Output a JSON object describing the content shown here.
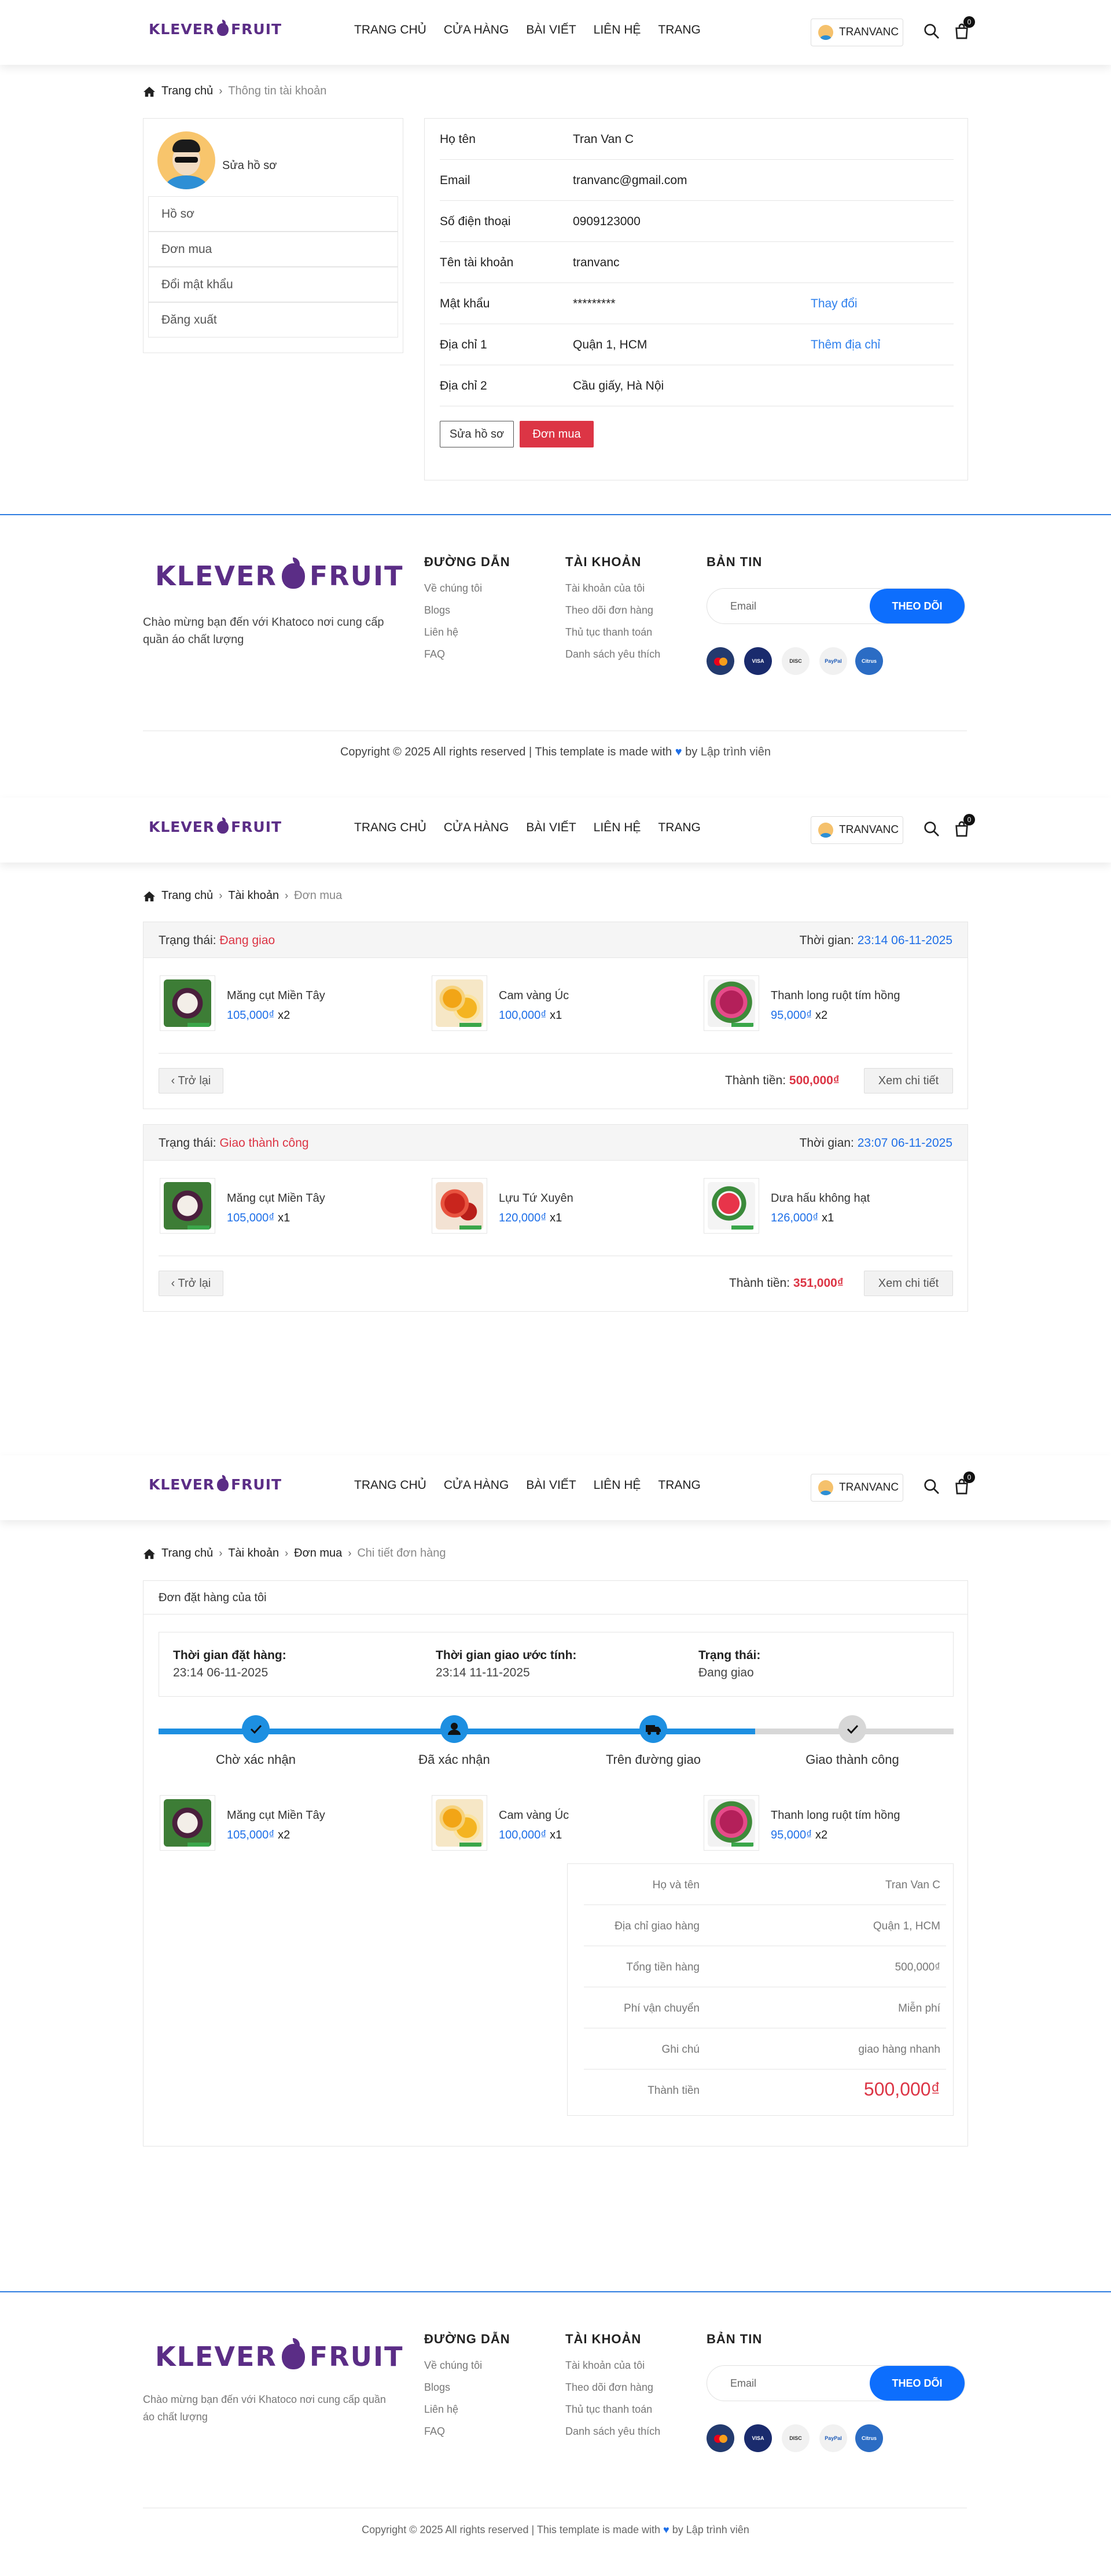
{
  "header": {
    "logo_left": "KLEVER",
    "logo_right": "FRUIT",
    "nav": [
      "TRANG CHỦ",
      "CỬA HÀNG",
      "BÀI VIẾT",
      "LIÊN HỆ",
      "TRANG"
    ],
    "username": "TRANVANC",
    "cart_count": "0"
  },
  "profile_page": {
    "breadcrumb": {
      "home": "Trang chủ",
      "current": "Thông tin tài khoản"
    },
    "sidebar": {
      "edit_label": "Sửa hồ sơ",
      "items": [
        "Hồ sơ",
        "Đơn mua",
        "Đổi mật khẩu",
        "Đăng xuất"
      ]
    },
    "rows": [
      {
        "label": "Họ tên",
        "value": "Tran Van C",
        "action": ""
      },
      {
        "label": "Email",
        "value": "tranvanc@gmail.com",
        "action": ""
      },
      {
        "label": "Số điện thoại",
        "value": "0909123000",
        "action": ""
      },
      {
        "label": "Tên tài khoản",
        "value": "tranvanc",
        "action": ""
      },
      {
        "label": "Mật khẩu",
        "value": "*********",
        "action": "Thay đổi"
      },
      {
        "label": "Địa chỉ 1",
        "value": "Quận 1, HCM",
        "action": "Thêm địa chỉ"
      },
      {
        "label": "Địa chỉ 2",
        "value": "Cầu giấy, Hà Nội",
        "action": ""
      }
    ],
    "edit_button": "Sửa hồ sơ",
    "orders_button": "Đơn mua"
  },
  "footer": {
    "logo_left": "KLEVER",
    "logo_right": "FRUIT",
    "description": "Chào mừng bạn đến với Khatoco nơi cung cấp quần áo chất lượng",
    "col1": {
      "title": "ĐƯỜNG DẪN",
      "links": [
        "Về chúng tôi",
        "Blogs",
        "Liên hệ",
        "FAQ"
      ]
    },
    "col2": {
      "title": "TÀI KHOẢN",
      "links": [
        "Tài khoản của tôi",
        "Theo dõi đơn hàng",
        "Thủ tục thanh toán",
        "Danh sách yêu thích"
      ]
    },
    "col3": {
      "title": "BẢN TIN",
      "email_placeholder": "Email",
      "subscribe": "THEO DÕI"
    },
    "payments": [
      "MasterCard",
      "VISA",
      "DISCOVER",
      "PayPal",
      "Citrus"
    ],
    "copyright_pre": "Copyright © 2025 All rights reserved | This template is made with",
    "copyright_by": "by",
    "copyright_author": "Lập trình viên"
  },
  "orders_page": {
    "breadcrumb": {
      "home": "Trang chủ",
      "mid": "Tài khoản",
      "current": "Đơn mua"
    },
    "status_label": "Trạng thái:",
    "time_label": "Thời gian:",
    "total_label": "Thành tiền:",
    "back_label": "Trở lại",
    "detail_label": "Xem chi tiết",
    "orders": [
      {
        "status": "Đang giao",
        "time": "23:14 06-11-2025",
        "items": [
          {
            "name": "Măng cụt Miền Tây",
            "price": "105,000₫",
            "qty": "x2"
          },
          {
            "name": "Cam vàng Úc",
            "price": "100,000₫",
            "qty": "x1"
          },
          {
            "name": "Thanh long ruột tím hồng",
            "price": "95,000₫",
            "qty": "x2"
          }
        ],
        "total": "500,000₫"
      },
      {
        "status": "Giao thành công",
        "time": "23:07 06-11-2025",
        "items": [
          {
            "name": "Măng cụt Miền Tây",
            "price": "105,000₫",
            "qty": "x1"
          },
          {
            "name": "Lựu Tứ Xuyên",
            "price": "120,000₫",
            "qty": "x1"
          },
          {
            "name": "Dưa hấu không hạt",
            "price": "126,000₫",
            "qty": "x1"
          }
        ],
        "total": "351,000₫"
      }
    ]
  },
  "detail_page": {
    "breadcrumb": {
      "home": "Trang chủ",
      "mid1": "Tài khoản",
      "mid2": "Đơn mua",
      "current": "Chi tiết đơn hàng"
    },
    "box_title": "Đơn đặt hàng của tôi",
    "order_time_label": "Thời gian đặt hàng:",
    "order_time": "23:14 06-11-2025",
    "eta_label": "Thời gian giao ước tính:",
    "eta": "23:14 11-11-2025",
    "status_label": "Trạng thái:",
    "status": "Đang giao",
    "steps": [
      "Chờ xác nhận",
      "Đã xác nhận",
      "Trên đường giao",
      "Giao thành công"
    ],
    "progress": 0.75,
    "items": [
      {
        "name": "Măng cụt Miền Tây",
        "price": "105,000₫",
        "qty": "x2"
      },
      {
        "name": "Cam vàng Úc",
        "price": "100,000₫",
        "qty": "x1"
      },
      {
        "name": "Thanh long ruột tím hồng",
        "price": "95,000₫",
        "qty": "x2"
      }
    ],
    "summary": [
      {
        "label": "Họ và tên",
        "value": "Tran Van C"
      },
      {
        "label": "Địa chỉ giao hàng",
        "value": "Quận 1, HCM"
      },
      {
        "label": "Tổng tiền hàng",
        "value": "500,000₫"
      },
      {
        "label": "Phí vận chuyển",
        "value": "Miễn phí"
      },
      {
        "label": "Ghi chú",
        "value": "giao hàng nhanh"
      },
      {
        "label": "Thành tiền",
        "value": "500,000₫"
      }
    ]
  },
  "colors": {
    "brand": "#5b2d86",
    "accent": "#1e6fe8",
    "danger": "#dc3545",
    "progress": "#1d8fe1"
  }
}
